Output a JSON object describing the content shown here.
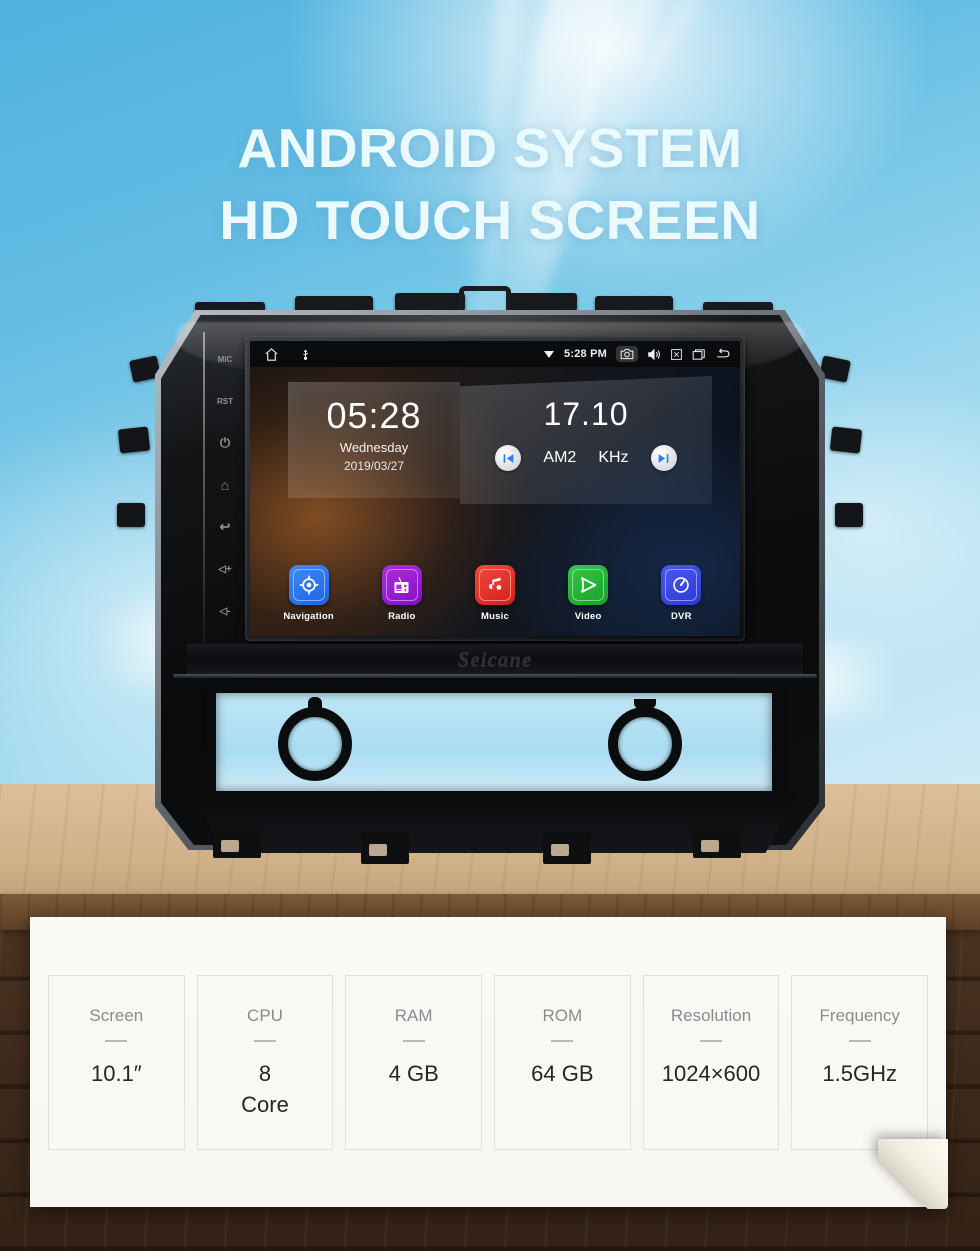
{
  "headline": {
    "line1": "ANDROID SYSTEM",
    "line2": "HD TOUCH SCREEN"
  },
  "colors": {
    "sky": "#63bce3",
    "table": "#d6b893",
    "floor": "#3e2a1b",
    "card": "#f9f8f5",
    "nav": "#2979f2",
    "radio": "#9b1fd1",
    "music": "#e8352e",
    "video": "#27b336",
    "dvr": "#3b4ee0"
  },
  "head_unit": {
    "brand": "Seicane",
    "side_buttons": [
      {
        "name": "mic",
        "label": "MIC"
      },
      {
        "name": "reset",
        "label": "RST"
      },
      {
        "name": "power",
        "label": "⏻"
      },
      {
        "name": "home",
        "label": "⌂"
      },
      {
        "name": "back",
        "label": "↩"
      },
      {
        "name": "volume-up",
        "label": "◁+"
      },
      {
        "name": "volume-down",
        "label": "◁-"
      }
    ],
    "screen": {
      "status_bar": {
        "time": "5:28 PM",
        "left_icons": [
          "home-icon",
          "usb-icon"
        ],
        "right_icons": [
          "wifi-icon",
          "camera-icon",
          "volume-icon",
          "close-icon",
          "recents-icon",
          "back-icon"
        ]
      },
      "clock_widget": {
        "time": "05:28",
        "weekday": "Wednesday",
        "date": "2019/03/27"
      },
      "radio_widget": {
        "frequency": "17.10",
        "band": "AM2",
        "unit": "KHz",
        "prev_icon": "skip-previous-icon",
        "next_icon": "skip-next-icon"
      },
      "apps": [
        {
          "label": "Navigation",
          "icon": "navigation-target-icon",
          "color": "#2979f2"
        },
        {
          "label": "Radio",
          "icon": "radio-icon",
          "color": "#9b1fd1"
        },
        {
          "label": "Music",
          "icon": "music-note-icon",
          "color": "#e8352e"
        },
        {
          "label": "Video",
          "icon": "video-play-icon",
          "color": "#27b336"
        },
        {
          "label": "DVR",
          "icon": "dvr-gauge-icon",
          "color": "#3b4ee0"
        }
      ]
    }
  },
  "specs": [
    {
      "key": "Screen",
      "value": "10.1″"
    },
    {
      "key": "CPU",
      "value": "8\nCore"
    },
    {
      "key": "RAM",
      "value": "4 GB"
    },
    {
      "key": "ROM",
      "value": "64 GB"
    },
    {
      "key": "Resolution",
      "value": "1024×600"
    },
    {
      "key": "Frequency",
      "value": "1.5GHz"
    }
  ]
}
